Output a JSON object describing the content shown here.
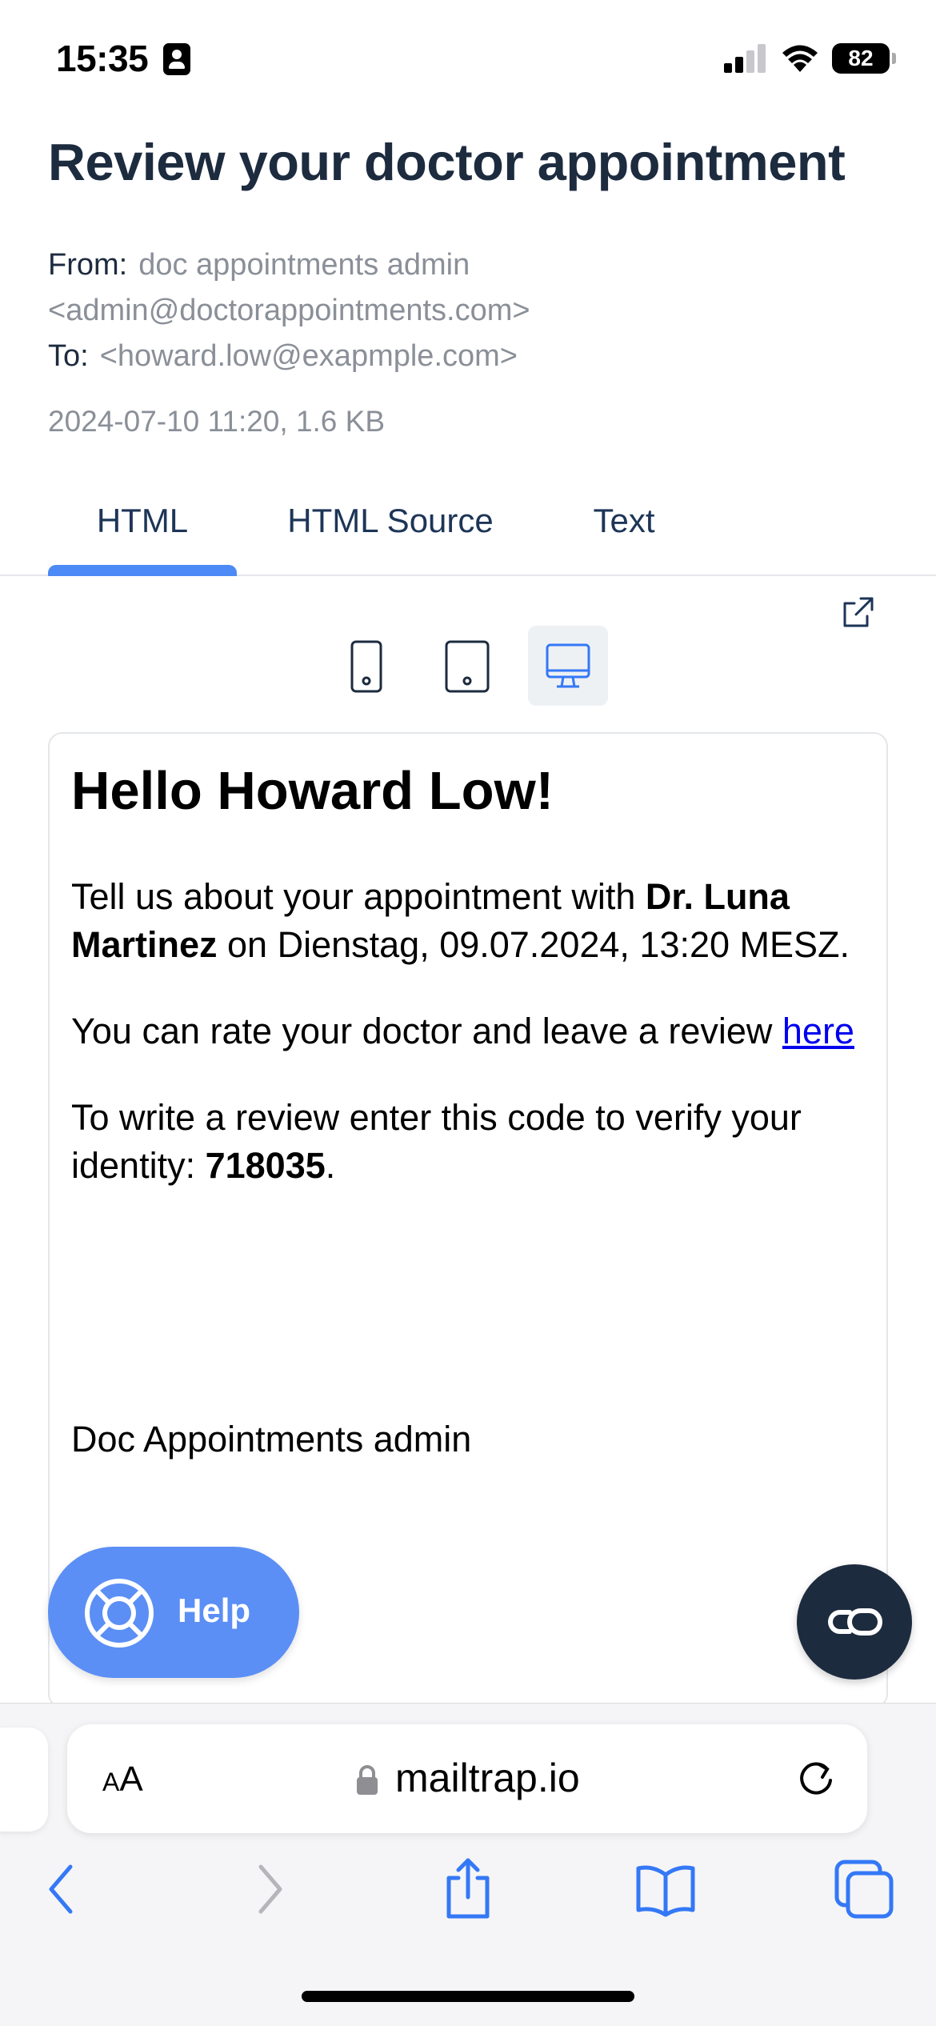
{
  "status_bar": {
    "time": "15:35",
    "battery": "82"
  },
  "email": {
    "subject": "Review your doctor appointment",
    "from_label": "From:",
    "from_value": "doc appointments admin <admin@doctorappointments.com>",
    "to_label": "To:",
    "to_value": "<howard.low@exapmple.com>",
    "date_size": "2024-07-10 11:20, 1.6 KB"
  },
  "tabs": [
    {
      "label": "HTML",
      "active": true
    },
    {
      "label": "HTML Source",
      "active": false
    },
    {
      "label": "Text",
      "active": false
    }
  ],
  "preview_devices": {
    "mobile": "mobile-icon",
    "tablet": "tablet-icon",
    "desktop": "desktop-icon",
    "selected": "desktop"
  },
  "email_body": {
    "greeting": "Hello Howard Low!",
    "p1_prefix": "Tell us about your appointment with ",
    "p1_doctor": "Dr. Luna Martinez",
    "p1_suffix": " on Dienstag, 09.07.2024, 13:20 MESZ.",
    "p2_text": "You can rate your doctor and leave a review ",
    "p2_link": "here",
    "p3_prefix": "To write a review enter this code to verify your identity: ",
    "p3_code": "718035",
    "p3_suffix": ".",
    "signature": "Doc Appointments admin"
  },
  "help_button": {
    "label": "Help"
  },
  "browser": {
    "url": "mailtrap.io",
    "text_size_small": "A",
    "text_size_large": "A"
  },
  "colors": {
    "accent": "#5b8ff5",
    "tab_underline": "#4c8af5",
    "title": "#1d2b3f",
    "muted": "#8a8f98",
    "link": "#0000ee",
    "ios_blue": "#3478f6"
  }
}
